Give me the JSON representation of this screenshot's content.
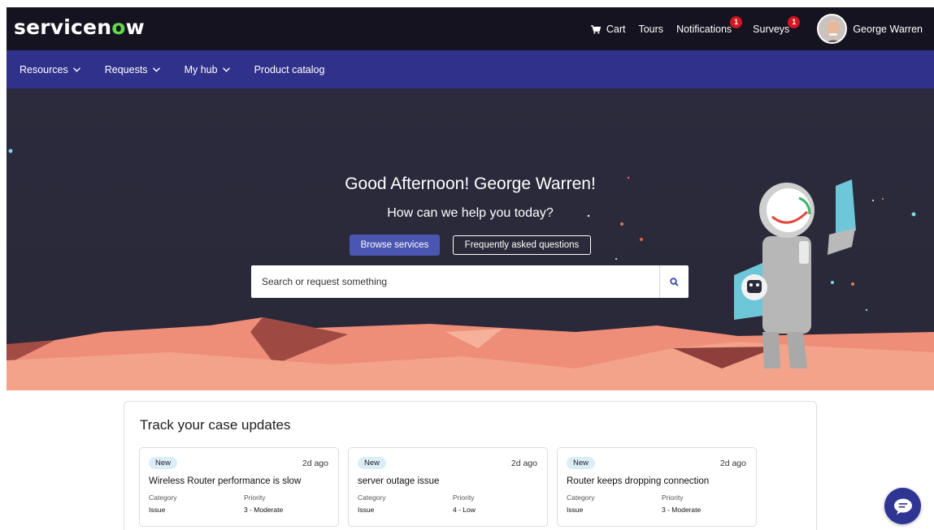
{
  "brand": {
    "logo_pre": "servicen",
    "logo_o": "o",
    "logo_post": "w"
  },
  "header": {
    "cart": "Cart",
    "tours": "Tours",
    "notifications": "Notifications",
    "notifications_count": "1",
    "surveys": "Surveys",
    "surveys_count": "1",
    "user_name": "George Warren"
  },
  "nav": {
    "resources": "Resources",
    "requests": "Requests",
    "my_hub": "My hub",
    "product_catalog": "Product catalog"
  },
  "hero": {
    "greeting": "Good Afternoon! George Warren!",
    "subtitle": "How can we help you today?",
    "browse_button": "Browse services",
    "faq_button": "Frequently asked questions",
    "search_placeholder": "Search or request something"
  },
  "cases": {
    "title": "Track your case updates",
    "items": [
      {
        "status": "New",
        "age": "2d ago",
        "title": "Wireless Router performance is slow",
        "category_label": "Category",
        "category": "Issue",
        "priority_label": "Priority",
        "priority": "3 - Moderate"
      },
      {
        "status": "New",
        "age": "2d ago",
        "title": "server outage issue",
        "category_label": "Category",
        "category": "Issue",
        "priority_label": "Priority",
        "priority": "4 - Low"
      },
      {
        "status": "New",
        "age": "2d ago",
        "title": "Router keeps dropping connection",
        "category_label": "Category",
        "category": "Issue",
        "priority_label": "Priority",
        "priority": "3 - Moderate"
      }
    ]
  },
  "colors": {
    "header_bg": "#15131f",
    "nav_bg": "#30318a",
    "hero_bg": "#2b2a3b",
    "accent_button": "#4b56b3",
    "logo_green": "#62d84e",
    "badge_red": "#d3161f",
    "dunes": "#f0907a"
  },
  "icons": [
    "cart-icon",
    "chevron-down-icon",
    "search-icon",
    "chat-icon",
    "avatar-photo"
  ]
}
